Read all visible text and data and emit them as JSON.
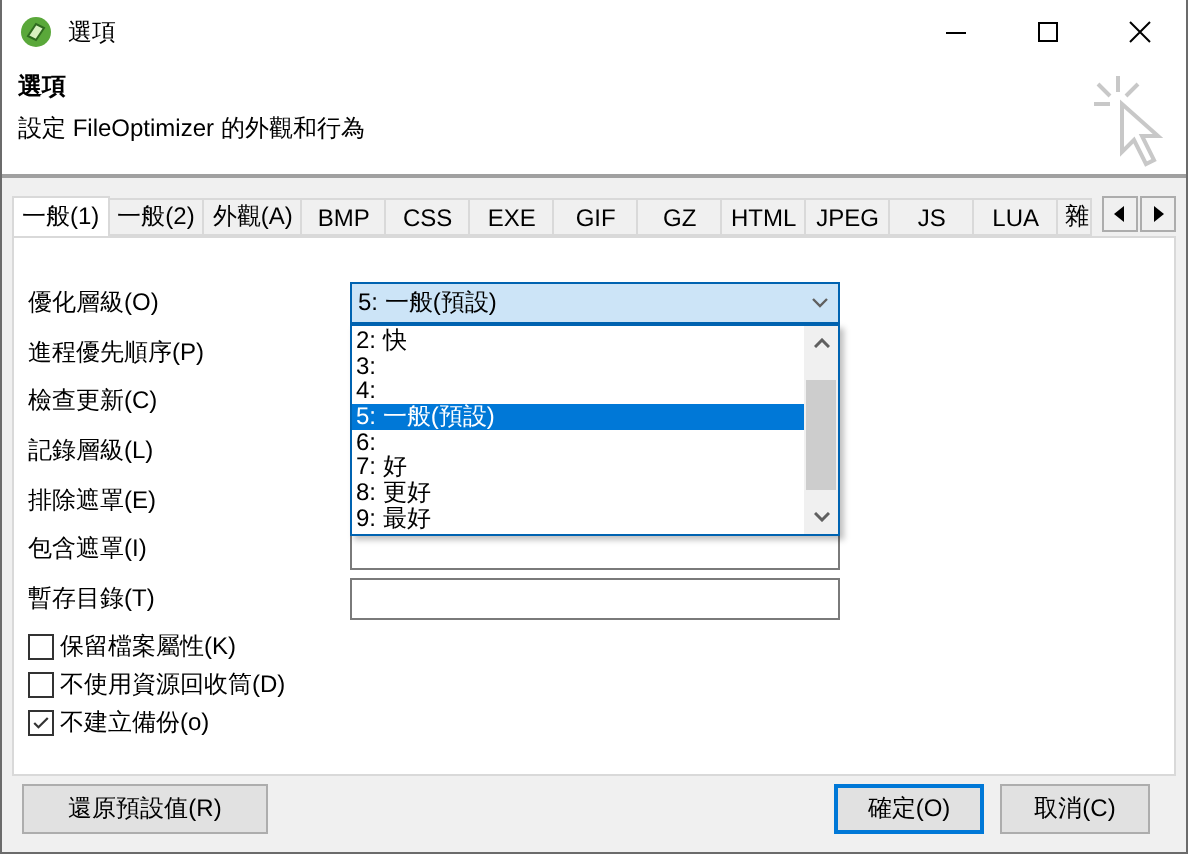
{
  "window": {
    "title": "選項"
  },
  "header": {
    "title": "選項",
    "subtitle": "設定 FileOptimizer 的外觀和行為"
  },
  "tabs": [
    {
      "label": "一般(1)",
      "selected": true
    },
    {
      "label": "一般(2)",
      "selected": false
    },
    {
      "label": "外觀(A)",
      "selected": false
    },
    {
      "label": "BMP",
      "selected": false
    },
    {
      "label": "CSS",
      "selected": false
    },
    {
      "label": "EXE",
      "selected": false
    },
    {
      "label": "GIF",
      "selected": false
    },
    {
      "label": "GZ",
      "selected": false
    },
    {
      "label": "HTML",
      "selected": false
    },
    {
      "label": "JPEG",
      "selected": false
    },
    {
      "label": "JS",
      "selected": false
    },
    {
      "label": "LUA",
      "selected": false
    },
    {
      "label": "雜",
      "selected": false
    }
  ],
  "settings": [
    {
      "label": "優化層級(O)",
      "kind": "combo",
      "value": "5: 一般(預設)"
    },
    {
      "label": "進程優先順序(P)",
      "kind": "covered"
    },
    {
      "label": "檢查更新(C)",
      "kind": "covered"
    },
    {
      "label": "記錄層級(L)",
      "kind": "covered"
    },
    {
      "label": "排除遮罩(E)",
      "kind": "covered"
    },
    {
      "label": "包含遮罩(I)",
      "kind": "text"
    },
    {
      "label": "暫存目錄(T)",
      "kind": "text"
    }
  ],
  "dropdown": {
    "options": [
      {
        "label": "2: 快",
        "selected": false
      },
      {
        "label": "3:",
        "selected": false
      },
      {
        "label": "4:",
        "selected": false
      },
      {
        "label": "5: 一般(預設)",
        "selected": true
      },
      {
        "label": "6:",
        "selected": false
      },
      {
        "label": "7: 好",
        "selected": false
      },
      {
        "label": "8: 更好",
        "selected": false
      },
      {
        "label": "9: 最好",
        "selected": false
      }
    ]
  },
  "checkboxes": [
    {
      "label": "保留檔案屬性(K)",
      "checked": false
    },
    {
      "label": "不使用資源回收筒(D)",
      "checked": false
    },
    {
      "label": "不建立備份(o)",
      "checked": true
    }
  ],
  "buttons": [
    {
      "label": "還原預設值(R)",
      "kind": "reset",
      "default": false
    },
    {
      "label": "確定(O)",
      "kind": "ok",
      "default": true
    },
    {
      "label": "取消(C)",
      "kind": "cancel",
      "default": false
    }
  ]
}
